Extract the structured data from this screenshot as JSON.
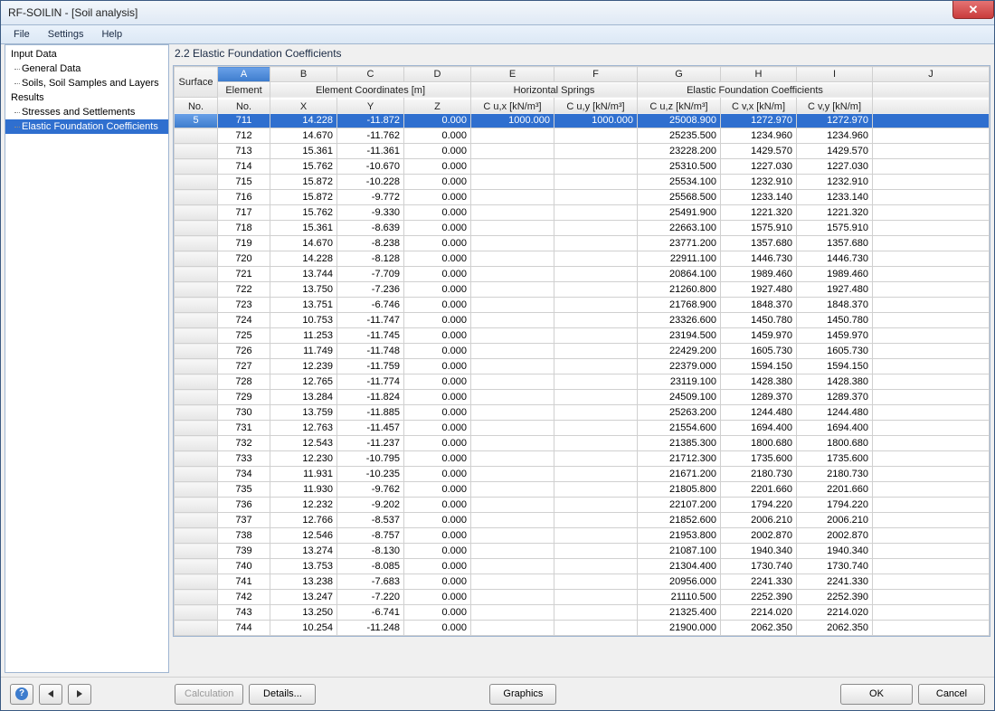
{
  "title": "RF-SOILIN - [Soil analysis]",
  "menu": [
    "File",
    "Settings",
    "Help"
  ],
  "sidebar": {
    "inputData": {
      "label": "Input Data",
      "children": [
        "General Data",
        "Soils, Soil Samples and Layers"
      ]
    },
    "results": {
      "label": "Results",
      "children": [
        "Stresses and Settlements",
        "Elastic Foundation Coefficients"
      ]
    },
    "selected": "Elastic Foundation Coefficients"
  },
  "pane_title": "2.2 Elastic Foundation Coefficients",
  "col_letters": [
    "A",
    "B",
    "C",
    "D",
    "E",
    "F",
    "G",
    "H",
    "I",
    "J"
  ],
  "group_headers": {
    "surface": "Surface",
    "element": "Element",
    "coords": "Element Coordinates [m]",
    "hsprings": "Horizontal Springs",
    "efc": "Elastic Foundation Coefficients"
  },
  "sub_headers": {
    "surface_no": "No.",
    "element_no": "No.",
    "x": "X",
    "y": "Y",
    "z": "Z",
    "cux": "C u,x [kN/m³]",
    "cuy": "C u,y [kN/m³]",
    "cuz": "C u,z [kN/m³]",
    "cvx": "C v,x [kN/m]",
    "cvy": "C v,y [kN/m]"
  },
  "surface_no": "5",
  "rows": [
    {
      "el": 711,
      "x": 14.228,
      "y": -11.872,
      "z": 0.0,
      "cux": 1000.0,
      "cuy": 1000.0,
      "cuz": 25008.9,
      "cvx": 1272.97,
      "cvy": 1272.97
    },
    {
      "el": 712,
      "x": 14.67,
      "y": -11.762,
      "z": 0.0,
      "cux": null,
      "cuy": null,
      "cuz": 25235.5,
      "cvx": 1234.96,
      "cvy": 1234.96
    },
    {
      "el": 713,
      "x": 15.361,
      "y": -11.361,
      "z": 0.0,
      "cux": null,
      "cuy": null,
      "cuz": 23228.2,
      "cvx": 1429.57,
      "cvy": 1429.57
    },
    {
      "el": 714,
      "x": 15.762,
      "y": -10.67,
      "z": 0.0,
      "cux": null,
      "cuy": null,
      "cuz": 25310.5,
      "cvx": 1227.03,
      "cvy": 1227.03
    },
    {
      "el": 715,
      "x": 15.872,
      "y": -10.228,
      "z": 0.0,
      "cux": null,
      "cuy": null,
      "cuz": 25534.1,
      "cvx": 1232.91,
      "cvy": 1232.91
    },
    {
      "el": 716,
      "x": 15.872,
      "y": -9.772,
      "z": 0.0,
      "cux": null,
      "cuy": null,
      "cuz": 25568.5,
      "cvx": 1233.14,
      "cvy": 1233.14
    },
    {
      "el": 717,
      "x": 15.762,
      "y": -9.33,
      "z": 0.0,
      "cux": null,
      "cuy": null,
      "cuz": 25491.9,
      "cvx": 1221.32,
      "cvy": 1221.32
    },
    {
      "el": 718,
      "x": 15.361,
      "y": -8.639,
      "z": 0.0,
      "cux": null,
      "cuy": null,
      "cuz": 22663.1,
      "cvx": 1575.91,
      "cvy": 1575.91
    },
    {
      "el": 719,
      "x": 14.67,
      "y": -8.238,
      "z": 0.0,
      "cux": null,
      "cuy": null,
      "cuz": 23771.2,
      "cvx": 1357.68,
      "cvy": 1357.68
    },
    {
      "el": 720,
      "x": 14.228,
      "y": -8.128,
      "z": 0.0,
      "cux": null,
      "cuy": null,
      "cuz": 22911.1,
      "cvx": 1446.73,
      "cvy": 1446.73
    },
    {
      "el": 721,
      "x": 13.744,
      "y": -7.709,
      "z": 0.0,
      "cux": null,
      "cuy": null,
      "cuz": 20864.1,
      "cvx": 1989.46,
      "cvy": 1989.46
    },
    {
      "el": 722,
      "x": 13.75,
      "y": -7.236,
      "z": 0.0,
      "cux": null,
      "cuy": null,
      "cuz": 21260.8,
      "cvx": 1927.48,
      "cvy": 1927.48
    },
    {
      "el": 723,
      "x": 13.751,
      "y": -6.746,
      "z": 0.0,
      "cux": null,
      "cuy": null,
      "cuz": 21768.9,
      "cvx": 1848.37,
      "cvy": 1848.37
    },
    {
      "el": 724,
      "x": 10.753,
      "y": -11.747,
      "z": 0.0,
      "cux": null,
      "cuy": null,
      "cuz": 23326.6,
      "cvx": 1450.78,
      "cvy": 1450.78
    },
    {
      "el": 725,
      "x": 11.253,
      "y": -11.745,
      "z": 0.0,
      "cux": null,
      "cuy": null,
      "cuz": 23194.5,
      "cvx": 1459.97,
      "cvy": 1459.97
    },
    {
      "el": 726,
      "x": 11.749,
      "y": -11.748,
      "z": 0.0,
      "cux": null,
      "cuy": null,
      "cuz": 22429.2,
      "cvx": 1605.73,
      "cvy": 1605.73
    },
    {
      "el": 727,
      "x": 12.239,
      "y": -11.759,
      "z": 0.0,
      "cux": null,
      "cuy": null,
      "cuz": 22379.0,
      "cvx": 1594.15,
      "cvy": 1594.15
    },
    {
      "el": 728,
      "x": 12.765,
      "y": -11.774,
      "z": 0.0,
      "cux": null,
      "cuy": null,
      "cuz": 23119.1,
      "cvx": 1428.38,
      "cvy": 1428.38
    },
    {
      "el": 729,
      "x": 13.284,
      "y": -11.824,
      "z": 0.0,
      "cux": null,
      "cuy": null,
      "cuz": 24509.1,
      "cvx": 1289.37,
      "cvy": 1289.37
    },
    {
      "el": 730,
      "x": 13.759,
      "y": -11.885,
      "z": 0.0,
      "cux": null,
      "cuy": null,
      "cuz": 25263.2,
      "cvx": 1244.48,
      "cvy": 1244.48
    },
    {
      "el": 731,
      "x": 12.763,
      "y": -11.457,
      "z": 0.0,
      "cux": null,
      "cuy": null,
      "cuz": 21554.6,
      "cvx": 1694.4,
      "cvy": 1694.4
    },
    {
      "el": 732,
      "x": 12.543,
      "y": -11.237,
      "z": 0.0,
      "cux": null,
      "cuy": null,
      "cuz": 21385.3,
      "cvx": 1800.68,
      "cvy": 1800.68
    },
    {
      "el": 733,
      "x": 12.23,
      "y": -10.795,
      "z": 0.0,
      "cux": null,
      "cuy": null,
      "cuz": 21712.3,
      "cvx": 1735.6,
      "cvy": 1735.6
    },
    {
      "el": 734,
      "x": 11.931,
      "y": -10.235,
      "z": 0.0,
      "cux": null,
      "cuy": null,
      "cuz": 21671.2,
      "cvx": 2180.73,
      "cvy": 2180.73
    },
    {
      "el": 735,
      "x": 11.93,
      "y": -9.762,
      "z": 0.0,
      "cux": null,
      "cuy": null,
      "cuz": 21805.8,
      "cvx": 2201.66,
      "cvy": 2201.66
    },
    {
      "el": 736,
      "x": 12.232,
      "y": -9.202,
      "z": 0.0,
      "cux": null,
      "cuy": null,
      "cuz": 22107.2,
      "cvx": 1794.22,
      "cvy": 1794.22
    },
    {
      "el": 737,
      "x": 12.766,
      "y": -8.537,
      "z": 0.0,
      "cux": null,
      "cuy": null,
      "cuz": 21852.6,
      "cvx": 2006.21,
      "cvy": 2006.21
    },
    {
      "el": 738,
      "x": 12.546,
      "y": -8.757,
      "z": 0.0,
      "cux": null,
      "cuy": null,
      "cuz": 21953.8,
      "cvx": 2002.87,
      "cvy": 2002.87
    },
    {
      "el": 739,
      "x": 13.274,
      "y": -8.13,
      "z": 0.0,
      "cux": null,
      "cuy": null,
      "cuz": 21087.1,
      "cvx": 1940.34,
      "cvy": 1940.34
    },
    {
      "el": 740,
      "x": 13.753,
      "y": -8.085,
      "z": 0.0,
      "cux": null,
      "cuy": null,
      "cuz": 21304.4,
      "cvx": 1730.74,
      "cvy": 1730.74
    },
    {
      "el": 741,
      "x": 13.238,
      "y": -7.683,
      "z": 0.0,
      "cux": null,
      "cuy": null,
      "cuz": 20956.0,
      "cvx": 2241.33,
      "cvy": 2241.33
    },
    {
      "el": 742,
      "x": 13.247,
      "y": -7.22,
      "z": 0.0,
      "cux": null,
      "cuy": null,
      "cuz": 21110.5,
      "cvx": 2252.39,
      "cvy": 2252.39
    },
    {
      "el": 743,
      "x": 13.25,
      "y": -6.741,
      "z": 0.0,
      "cux": null,
      "cuy": null,
      "cuz": 21325.4,
      "cvx": 2214.02,
      "cvy": 2214.02
    },
    {
      "el": 744,
      "x": 10.254,
      "y": -11.248,
      "z": 0.0,
      "cux": null,
      "cuy": null,
      "cuz": 21900.0,
      "cvx": 2062.35,
      "cvy": 2062.35
    }
  ],
  "buttons": {
    "calculation": "Calculation",
    "details": "Details...",
    "graphics": "Graphics",
    "ok": "OK",
    "cancel": "Cancel"
  }
}
